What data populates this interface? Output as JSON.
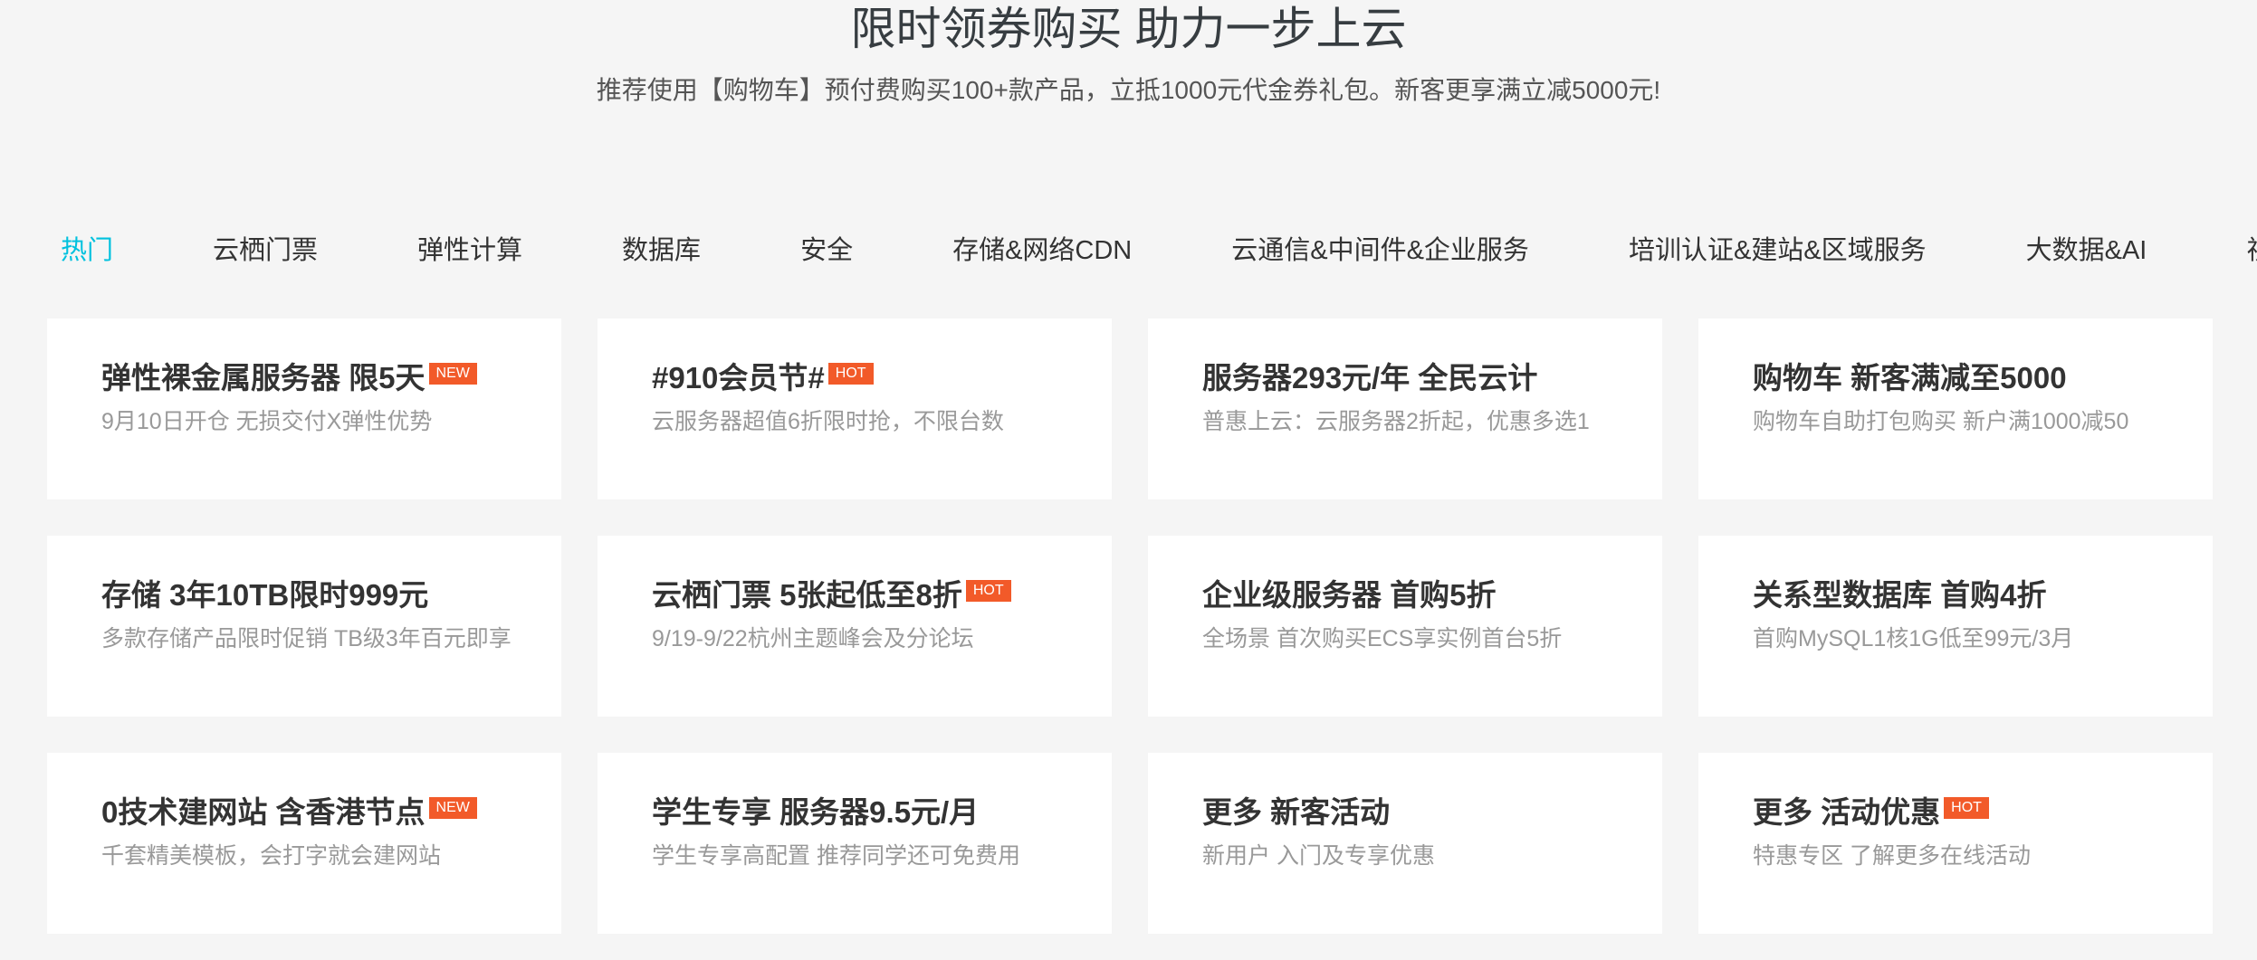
{
  "hero": {
    "title": "限时领券购买 助力一步上云",
    "subtitle": "推荐使用【购物车】预付费购买100+款产品，立抵1000元代金券礼包。新客更享满立减5000元!"
  },
  "tabs": [
    {
      "label": "热门",
      "active": true
    },
    {
      "label": "云栖门票",
      "active": false
    },
    {
      "label": "弹性计算",
      "active": false
    },
    {
      "label": "数据库",
      "active": false
    },
    {
      "label": "安全",
      "active": false
    },
    {
      "label": "存储&网络CDN",
      "active": false
    },
    {
      "label": "云通信&中间件&企业服务",
      "active": false
    },
    {
      "label": "培训认证&建站&区域服务",
      "active": false
    },
    {
      "label": "大数据&AI",
      "active": false
    },
    {
      "label": "视频其他",
      "active": false
    }
  ],
  "cards": [
    {
      "title": "弹性裸金属服务器 限5天",
      "badge": "NEW",
      "desc": "9月10日开仓 无损交付X弹性优势"
    },
    {
      "title": "#910会员节#",
      "badge": "HOT",
      "desc": "云服务器超值6折限时抢，不限台数"
    },
    {
      "title": "服务器293元/年 全民云计",
      "badge": "",
      "desc": "普惠上云：云服务器2折起，优惠多选1"
    },
    {
      "title": "购物车 新客满减至5000",
      "badge": "",
      "desc": "购物车自助打包购买 新户满1000减50"
    },
    {
      "title": "存储 3年10TB限时999元",
      "badge": "",
      "desc": "多款存储产品限时促销 TB级3年百元即享"
    },
    {
      "title": "云栖门票 5张起低至8折",
      "badge": "HOT",
      "desc": "9/19-9/22杭州主题峰会及分论坛"
    },
    {
      "title": "企业级服务器 首购5折",
      "badge": "",
      "desc": "全场景 首次购买ECS享实例首台5折"
    },
    {
      "title": "关系型数据库 首购4折",
      "badge": "",
      "desc": "首购MySQL1核1G低至99元/3月"
    },
    {
      "title": "0技术建网站 含香港节点",
      "badge": "NEW",
      "desc": "千套精美模板，会打字就会建网站"
    },
    {
      "title": "学生专享 服务器9.5元/月",
      "badge": "",
      "desc": "学生专享高配置 推荐同学还可免费用"
    },
    {
      "title": "更多 新客活动",
      "badge": "",
      "desc": "新用户 入门及专享优惠"
    },
    {
      "title": "更多 活动优惠",
      "badge": "HOT",
      "desc": "特惠专区 了解更多在线活动"
    }
  ],
  "colors": {
    "accent": "#00c1de",
    "badge": "#f25a29",
    "background": "#f5f5f5"
  }
}
